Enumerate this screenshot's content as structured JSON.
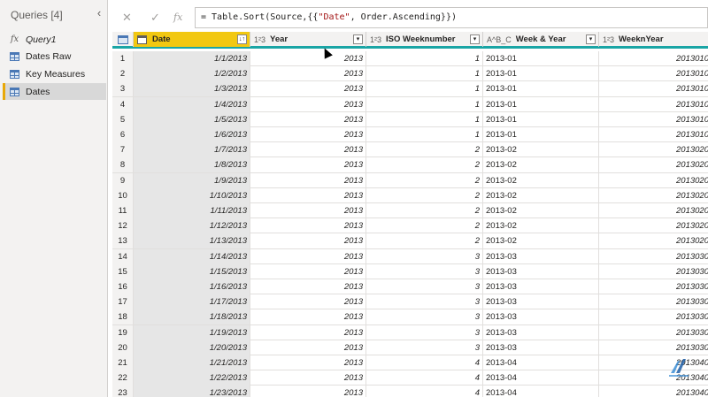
{
  "queries": {
    "title": "Queries [4]",
    "collapse_icon": "‹",
    "items": [
      {
        "label": "Query1",
        "icon": "fx-icon",
        "selected": false
      },
      {
        "label": "Dates Raw",
        "icon": "table-icon",
        "selected": false
      },
      {
        "label": "Key Measures",
        "icon": "table-icon",
        "selected": false
      },
      {
        "label": "Dates",
        "icon": "table-icon",
        "selected": true
      }
    ]
  },
  "formula_bar": {
    "cancel": "✕",
    "commit": "✓",
    "fx": "fx",
    "formula_prefix": "= Table.Sort(Source,{{",
    "formula_string": "\"Date\"",
    "formula_suffix": ", Order.Ascending}})"
  },
  "columns": [
    {
      "name": "Date",
      "type_icon": "date-type-icon",
      "filter": "↓↑"
    },
    {
      "name": "Year",
      "type_icon": "1²3",
      "filter": "▾"
    },
    {
      "name": "ISO Weeknumber",
      "type_icon": "1²3",
      "filter": "▾"
    },
    {
      "name": "Week & Year",
      "type_icon": "A^B_C",
      "filter": "▾"
    },
    {
      "name": "WeeknYear",
      "type_icon": "1²3",
      "filter": "▾"
    }
  ],
  "rows": [
    [
      "1",
      "1/1/2013",
      "2013",
      "1",
      "2013-01",
      "2013010"
    ],
    [
      "2",
      "1/2/2013",
      "2013",
      "1",
      "2013-01",
      "2013010"
    ],
    [
      "3",
      "1/3/2013",
      "2013",
      "1",
      "2013-01",
      "2013010"
    ],
    [
      "4",
      "1/4/2013",
      "2013",
      "1",
      "2013-01",
      "2013010"
    ],
    [
      "5",
      "1/5/2013",
      "2013",
      "1",
      "2013-01",
      "2013010"
    ],
    [
      "6",
      "1/6/2013",
      "2013",
      "1",
      "2013-01",
      "2013010"
    ],
    [
      "7",
      "1/7/2013",
      "2013",
      "2",
      "2013-02",
      "2013020"
    ],
    [
      "8",
      "1/8/2013",
      "2013",
      "2",
      "2013-02",
      "2013020"
    ],
    [
      "9",
      "1/9/2013",
      "2013",
      "2",
      "2013-02",
      "2013020"
    ],
    [
      "10",
      "1/10/2013",
      "2013",
      "2",
      "2013-02",
      "2013020"
    ],
    [
      "11",
      "1/11/2013",
      "2013",
      "2",
      "2013-02",
      "2013020"
    ],
    [
      "12",
      "1/12/2013",
      "2013",
      "2",
      "2013-02",
      "2013020"
    ],
    [
      "13",
      "1/13/2013",
      "2013",
      "2",
      "2013-02",
      "2013020"
    ],
    [
      "14",
      "1/14/2013",
      "2013",
      "3",
      "2013-03",
      "2013030"
    ],
    [
      "15",
      "1/15/2013",
      "2013",
      "3",
      "2013-03",
      "2013030"
    ],
    [
      "16",
      "1/16/2013",
      "2013",
      "3",
      "2013-03",
      "2013030"
    ],
    [
      "17",
      "1/17/2013",
      "2013",
      "3",
      "2013-03",
      "2013030"
    ],
    [
      "18",
      "1/18/2013",
      "2013",
      "3",
      "2013-03",
      "2013030"
    ],
    [
      "19",
      "1/19/2013",
      "2013",
      "3",
      "2013-03",
      "2013030"
    ],
    [
      "20",
      "1/20/2013",
      "2013",
      "3",
      "2013-03",
      "2013030"
    ],
    [
      "21",
      "1/21/2013",
      "2013",
      "4",
      "2013-04",
      "2013040"
    ],
    [
      "22",
      "1/22/2013",
      "2013",
      "4",
      "2013-04",
      "2013040"
    ],
    [
      "23",
      "1/23/2013",
      "2013",
      "4",
      "2013-04",
      "2013040"
    ]
  ],
  "colors": {
    "accent": "#f2c811",
    "header_rule": "#1aa5a5",
    "selected_marker": "#e8a808"
  }
}
